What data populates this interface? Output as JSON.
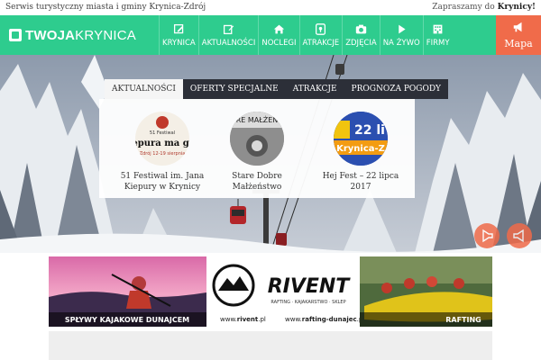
{
  "topstrip": {
    "left_text": "Serwis turystyczny miasta i gminy Krynica-Zdrój",
    "right_prefix": "Zapraszamy do ",
    "right_bold": "Krynicy!"
  },
  "logo": {
    "part1": "TWOJA",
    "part2": "KRYNICA"
  },
  "nav": {
    "items": [
      {
        "label": "KRYNICA",
        "icon": "pencil-icon"
      },
      {
        "label": "AKTUALNOŚCI",
        "icon": "edit-icon"
      },
      {
        "label": "NOCLEGI",
        "icon": "home-icon"
      },
      {
        "label": "ATRAKCJE",
        "icon": "map-pin-icon"
      },
      {
        "label": "ZDJĘCIA",
        "icon": "camera-icon"
      },
      {
        "label": "NA ŻYWO",
        "icon": "play-icon"
      },
      {
        "label": "FIRMY",
        "icon": "building-icon"
      }
    ],
    "map_label": "Mapa"
  },
  "tabs": [
    "AKTUALNOŚCI",
    "OFERTY SPECJALNE",
    "ATRAKCJE",
    "PROGNOZA POGODY"
  ],
  "cards": [
    {
      "caption": "51 Festiwal im. Jana Kiepury w Krynicy",
      "thumb_text_top": "51 Festiwal",
      "thumb_text_main": "epura ma gł",
      "thumb_text_sub": "Zdrój 12-19 sierpnia"
    },
    {
      "caption": "Stare Dobre Małżeństwo",
      "thumb_text_top": "RE MAŁŻEN"
    },
    {
      "caption": "Hej Fest – 22 lipca 2017",
      "thumb_text_top": "22 li",
      "thumb_text_main": "Krynica-Z"
    }
  ],
  "banner": {
    "left_caption": "SPŁYWY KAJAKOWE DUNAJCEM",
    "brand": "RIVENT",
    "brand_sub": "RAFTING · KAJAKARSTWO · SKLEP",
    "url1_prefix": "www.",
    "url1_bold": "rivent",
    "url1_suffix": ".pl",
    "url2_prefix": "www.",
    "url2_bold": "rafting-dunajec",
    "url2_suffix": ".pl",
    "right_caption": "RAFTING"
  },
  "colors": {
    "nav_green": "#2ecc8e",
    "accent_orange": "#f06b4a",
    "tab_dark": "#2c2f38"
  }
}
